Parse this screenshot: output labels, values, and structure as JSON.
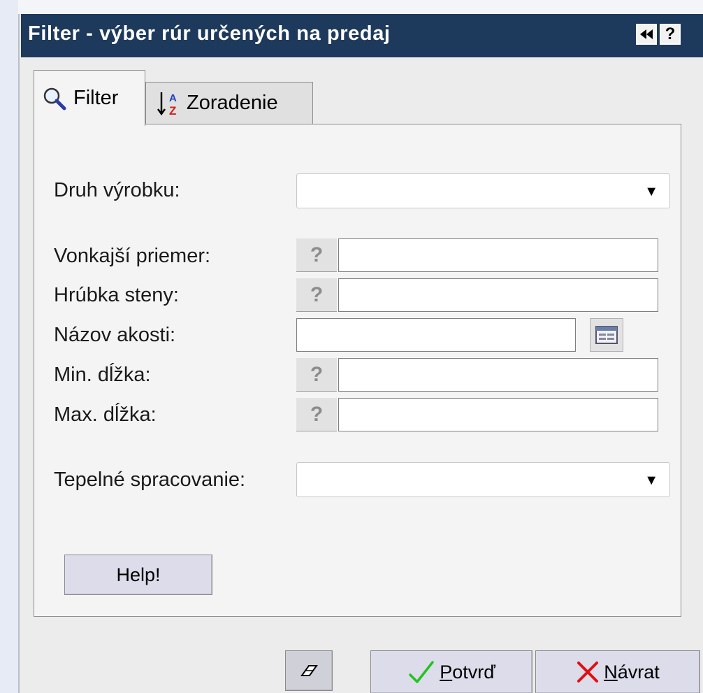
{
  "window": {
    "title": "Filter - výber rúr určených na predaj",
    "help_button_glyph": "?"
  },
  "tabs": [
    {
      "label": "Filter",
      "icon": "magnifier-icon",
      "active": true
    },
    {
      "label": "Zoradenie",
      "icon": "sort-az-icon",
      "active": false
    }
  ],
  "form": {
    "druh_vyrobku": {
      "label": "Druh výrobku:",
      "value": ""
    },
    "vonkajsi_priemer": {
      "label": "Vonkajší priemer:",
      "value": ""
    },
    "hrubka_steny": {
      "label": "Hrúbka steny:",
      "value": ""
    },
    "nazov_akosti": {
      "label": "Názov akosti:",
      "value": ""
    },
    "min_dlzka": {
      "label": "Min. dĺžka:",
      "value": ""
    },
    "max_dlzka": {
      "label": "Max. dĺžka:",
      "value": ""
    },
    "tepelne_spracovanie": {
      "label": "Tepelné spracovanie:",
      "value": ""
    },
    "hint_glyph": "?"
  },
  "buttons": {
    "help": "Help!",
    "confirm_first": "P",
    "confirm_rest": "otvrď",
    "back_first": "N",
    "back_rest": "ávrat"
  },
  "colors": {
    "titlebar": "#1d3a5c",
    "confirm_check": "#22c41f",
    "back_cross": "#e01010"
  }
}
